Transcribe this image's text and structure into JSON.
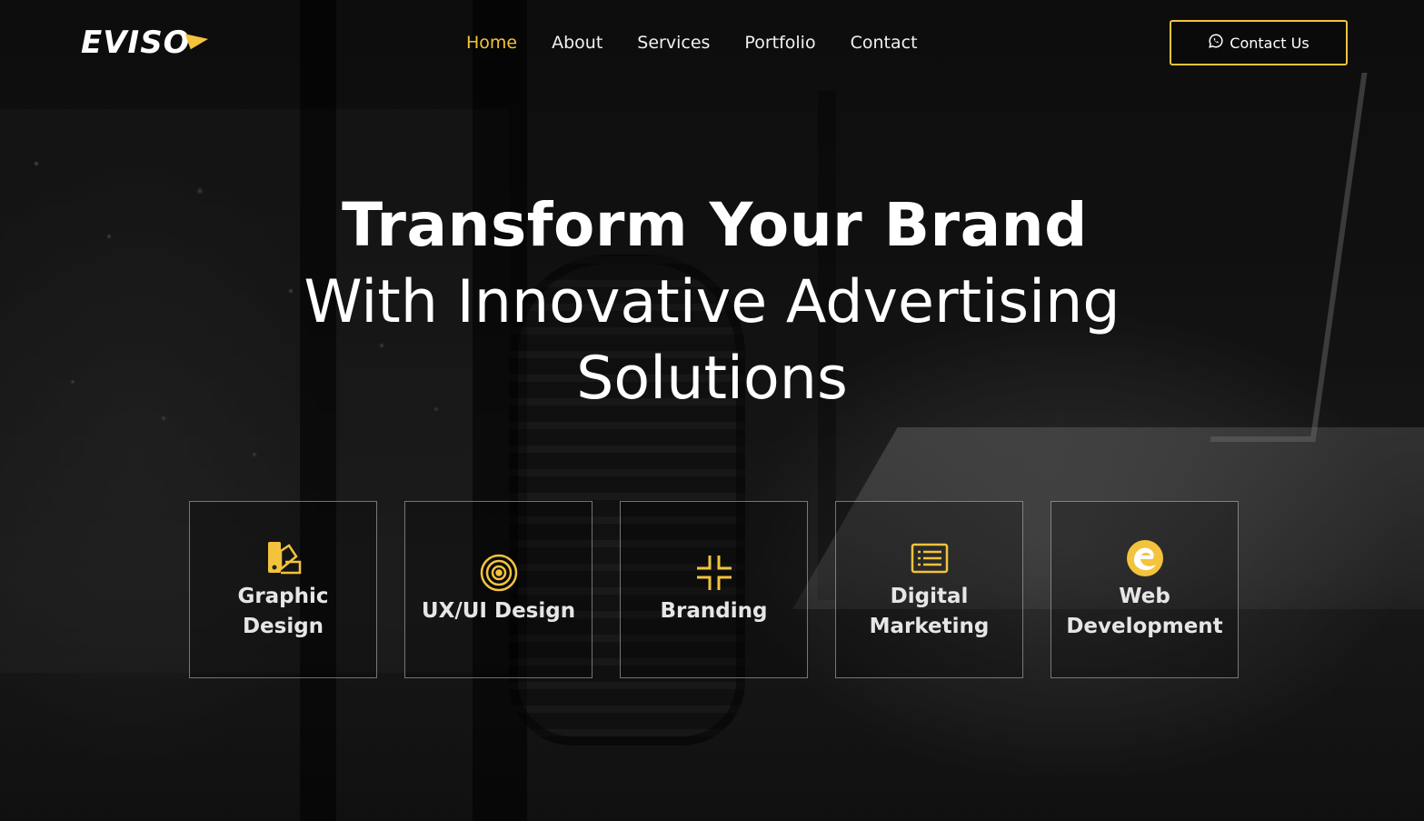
{
  "brand": {
    "logo_text": "EVISO",
    "accent_color": "#f3c33d"
  },
  "nav": {
    "items": [
      {
        "label": "Home",
        "active": true
      },
      {
        "label": "About",
        "active": false
      },
      {
        "label": "Services",
        "active": false
      },
      {
        "label": "Portfolio",
        "active": false
      },
      {
        "label": "Contact",
        "active": false
      }
    ]
  },
  "header": {
    "contact_button": {
      "label": "Contact Us",
      "icon": "whatsapp-icon"
    }
  },
  "hero": {
    "headline_bold": "Transform Your Brand",
    "headline_rest": "With Innovative Advertising Solutions"
  },
  "services": [
    {
      "label": "Graphic Design",
      "icon": "palette-swatch-icon"
    },
    {
      "label": "UX/UI Design",
      "icon": "target-circles-icon"
    },
    {
      "label": "Branding",
      "icon": "collapse-corners-icon"
    },
    {
      "label": "Digital Marketing",
      "icon": "list-panel-icon"
    },
    {
      "label": "Web Development",
      "icon": "edge-browser-icon"
    }
  ]
}
